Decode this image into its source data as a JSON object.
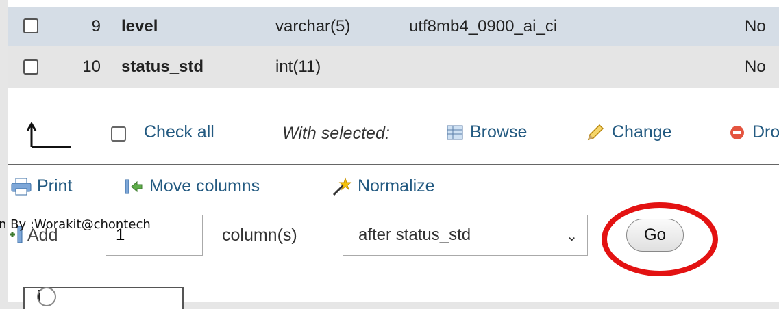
{
  "rows": [
    {
      "num": "9",
      "name": "level",
      "type": "varchar(5)",
      "collation": "utf8mb4_0900_ai_ci",
      "null": "No"
    },
    {
      "num": "10",
      "name": "status_std",
      "type": "int(11)",
      "collation": "",
      "null": "No"
    }
  ],
  "actions": {
    "check_all": "Check all",
    "with_selected": "With selected:",
    "browse": "Browse",
    "change": "Change",
    "drop": "Dro"
  },
  "tools": {
    "print": "Print",
    "move_columns": "Move columns",
    "normalize": "Normalize"
  },
  "add_form": {
    "label": "Add",
    "count": "1",
    "suffix": "column(s)",
    "position": "after status_std",
    "go": "Go"
  },
  "watermark": "n By :Worakit@chontech",
  "colors": {
    "row_highlight": "#d5dde6",
    "row_alt": "#e5e5e5",
    "link": "#235a81",
    "annotation": "#e31212"
  }
}
